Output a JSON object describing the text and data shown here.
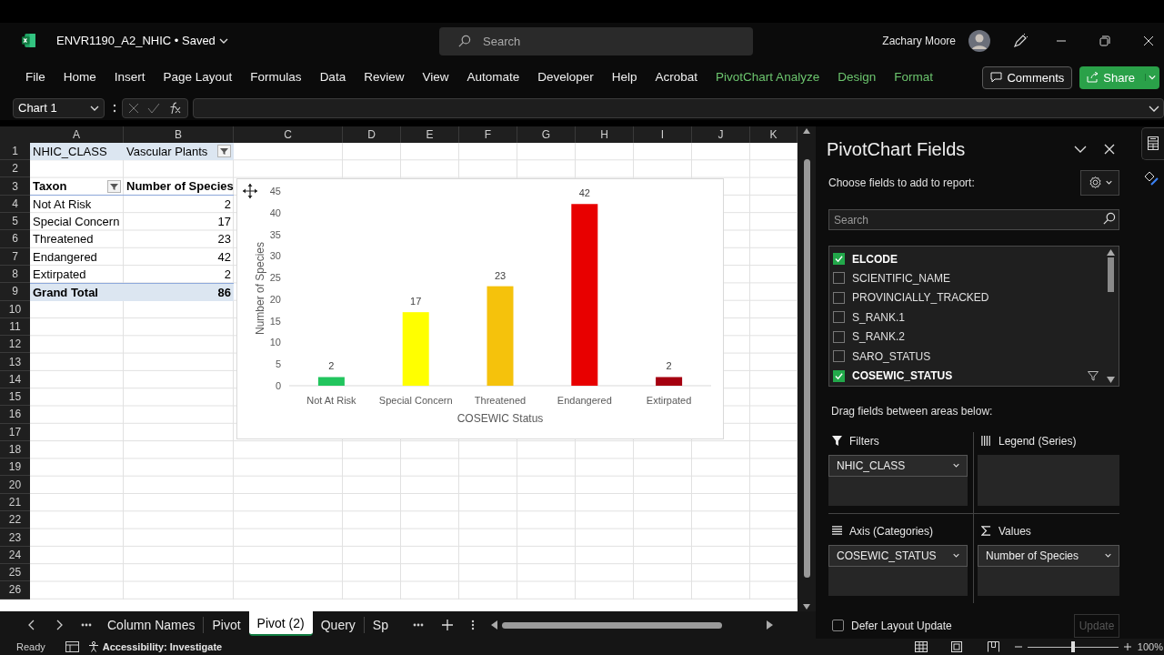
{
  "title_bar": {
    "document_title": "ENVR1190_A2_NHIC • Saved",
    "search_placeholder": "Search",
    "user_name": "Zachary Moore"
  },
  "ribbon_tabs": [
    {
      "label": "File",
      "kind": "standard"
    },
    {
      "label": "Home",
      "kind": "standard"
    },
    {
      "label": "Insert",
      "kind": "standard"
    },
    {
      "label": "Page Layout",
      "kind": "standard"
    },
    {
      "label": "Formulas",
      "kind": "standard"
    },
    {
      "label": "Data",
      "kind": "standard"
    },
    {
      "label": "Review",
      "kind": "standard"
    },
    {
      "label": "View",
      "kind": "standard"
    },
    {
      "label": "Automate",
      "kind": "standard"
    },
    {
      "label": "Developer",
      "kind": "standard"
    },
    {
      "label": "Help",
      "kind": "standard"
    },
    {
      "label": "Acrobat",
      "kind": "standard"
    },
    {
      "label": "PivotChart Analyze",
      "kind": "contextual"
    },
    {
      "label": "Design",
      "kind": "contextual"
    },
    {
      "label": "Format",
      "kind": "contextual"
    }
  ],
  "comments_button": "Comments",
  "share_button": "Share",
  "formula_bar": {
    "name_box": "Chart 1"
  },
  "sheet": {
    "columns": [
      "A",
      "B",
      "C",
      "D",
      "E",
      "F",
      "G",
      "H",
      "I",
      "J",
      "K"
    ],
    "row_numbers": [
      "1",
      "2",
      "3",
      "4",
      "5",
      "6",
      "7",
      "8",
      "9",
      "10",
      "11",
      "12",
      "13",
      "14",
      "15",
      "16",
      "17",
      "18",
      "19",
      "20",
      "21",
      "22",
      "23",
      "24",
      "25",
      "26"
    ],
    "pivot_rows": [
      {
        "kind": "filter",
        "cells": [
          {
            "text": "NHIC_CLASS",
            "filter_button": false
          },
          {
            "text": "Vascular Plants",
            "filter_button": true
          }
        ]
      },
      {
        "kind": "blank"
      },
      {
        "kind": "header",
        "cells": [
          {
            "text": "Taxon",
            "filter_button": true
          },
          {
            "text": "Number of Species",
            "filter_button": false
          }
        ]
      },
      {
        "kind": "item",
        "cells": [
          {
            "text": "Not At Risk",
            "filter_button": false
          },
          {
            "text": "2",
            "filter_button": false
          }
        ]
      },
      {
        "kind": "item",
        "cells": [
          {
            "text": "Special Concern",
            "filter_button": false
          },
          {
            "text": "17",
            "filter_button": false
          }
        ]
      },
      {
        "kind": "item",
        "cells": [
          {
            "text": "Threatened",
            "filter_button": false
          },
          {
            "text": "23",
            "filter_button": false
          }
        ]
      },
      {
        "kind": "item",
        "cells": [
          {
            "text": "Endangered",
            "filter_button": false
          },
          {
            "text": "42",
            "filter_button": false
          }
        ]
      },
      {
        "kind": "item",
        "cells": [
          {
            "text": "Extirpated",
            "filter_button": false
          },
          {
            "text": "2",
            "filter_button": false
          }
        ]
      },
      {
        "kind": "total",
        "cells": [
          {
            "text": "Grand Total",
            "filter_button": false
          },
          {
            "text": "86",
            "filter_button": false
          }
        ]
      }
    ]
  },
  "pivot_chart": {
    "chart_data": {
      "type": "bar",
      "xlabel": "COSEWIC Status",
      "ylabel": "Number of Species",
      "categories": [
        "Not At Risk",
        "Special Concern",
        "Threatened",
        "Endangered",
        "Extirpated"
      ],
      "series": [
        {
          "values": [
            2,
            17,
            23,
            42,
            2
          ],
          "colors": [
            "#22c55e",
            "#ffff00",
            "#f5c20c",
            "#e80000",
            "#a50010"
          ]
        }
      ],
      "ylim": [
        0,
        45
      ],
      "yticks": [
        0,
        5,
        10,
        15,
        20,
        25,
        30,
        35,
        40,
        45
      ],
      "data_labels": true
    }
  },
  "sheet_tabs": [
    {
      "label": "Column Names",
      "selected": false
    },
    {
      "label": "Pivot",
      "selected": false
    },
    {
      "label": "Pivot (2)",
      "selected": true
    },
    {
      "label": "Query",
      "selected": false
    },
    {
      "label": "Sp",
      "selected": false
    }
  ],
  "field_pane": {
    "title": "PivotChart Fields",
    "prompt": "Choose fields to add to report:",
    "search_placeholder": "Search",
    "fields": [
      {
        "name": "ELCODE",
        "checked": true,
        "filtered": false
      },
      {
        "name": "SCIENTIFIC_NAME",
        "checked": false,
        "filtered": false
      },
      {
        "name": "PROVINCIALLY_TRACKED",
        "checked": false,
        "filtered": false
      },
      {
        "name": "S_RANK.1",
        "checked": false,
        "filtered": false
      },
      {
        "name": "S_RANK.2",
        "checked": false,
        "filtered": false
      },
      {
        "name": "SARO_STATUS",
        "checked": false,
        "filtered": false
      },
      {
        "name": "COSEWIC_STATUS",
        "checked": true,
        "filtered": true
      }
    ],
    "areas_prompt": "Drag fields between areas below:",
    "areas": [
      {
        "kind": "filters",
        "title": "Filters",
        "fields": [
          "NHIC_CLASS"
        ]
      },
      {
        "kind": "legend",
        "title": "Legend (Series)"
      },
      {
        "kind": "axis",
        "title": "Axis (Categories)",
        "fields": [
          "COSEWIC_STATUS"
        ]
      },
      {
        "kind": "values",
        "title": "Values",
        "fields": [
          "Number of Species"
        ]
      }
    ],
    "defer_update": {
      "label": "Defer Layout Update",
      "checked": false
    },
    "update_button": {
      "label": "Update",
      "disabled": true
    }
  },
  "status_bar": {
    "ready": "Ready",
    "accessibility": "Accessibility: Investigate",
    "zoom": "100%",
    "level": 0.5
  }
}
